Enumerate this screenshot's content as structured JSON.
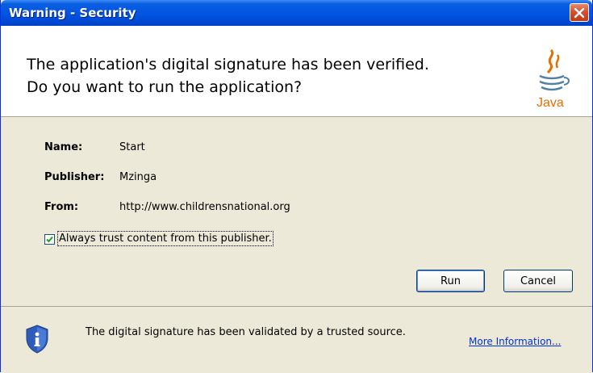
{
  "window": {
    "title": "Warning - Security"
  },
  "header": {
    "line1": "The application's digital signature has been verified.",
    "line2": "Do you want to run the application?",
    "logo_text": "Java"
  },
  "fields": [
    {
      "label": "Name:",
      "value": "Start"
    },
    {
      "label": "Publisher:",
      "value": "Mzinga"
    },
    {
      "label": "From:",
      "value": "http://www.childrensnational.org"
    }
  ],
  "checkbox": {
    "label": "Always trust content from this publisher.",
    "checked": true
  },
  "buttons": {
    "run": "Run",
    "cancel": "Cancel"
  },
  "footer": {
    "message": "The digital signature has been validated by a trusted source.",
    "more_info": "More Information..."
  },
  "colors": {
    "titlebar": "#0054e3",
    "close": "#d6502c",
    "link": "#0033cc",
    "java_red": "#e76f00",
    "java_blue": "#5382a1"
  }
}
